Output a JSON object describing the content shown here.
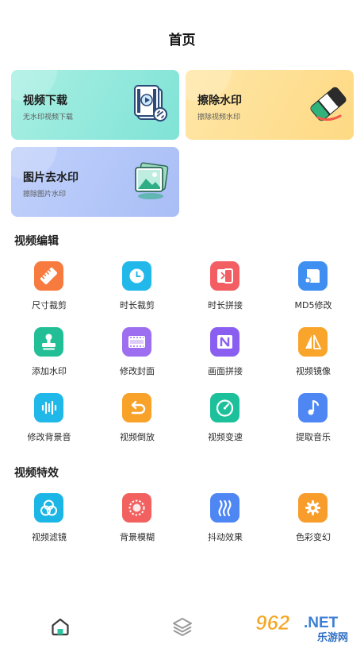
{
  "header": {
    "title": "首页"
  },
  "cards": [
    {
      "title": "视频下载",
      "subtitle": "无水印视频下载",
      "icon": "video-file-link-icon"
    },
    {
      "title": "擦除水印",
      "subtitle": "擦除视频水印",
      "icon": "eraser-icon"
    },
    {
      "title": "图片去水印",
      "subtitle": "擦除图片水印",
      "icon": "image-stack-icon"
    }
  ],
  "sections": {
    "edit": {
      "title": "视频编辑",
      "items": [
        {
          "label": "尺寸裁剪",
          "icon": "ruler-icon",
          "color": "#f77b3f"
        },
        {
          "label": "时长裁剪",
          "icon": "clock-icon",
          "color": "#22b9ea"
        },
        {
          "label": "时长拼接",
          "icon": "merge-icon",
          "color": "#f35e63"
        },
        {
          "label": "MD5修改",
          "icon": "document-icon",
          "color": "#3f8ff2"
        },
        {
          "label": "添加水印",
          "icon": "stamp-icon",
          "color": "#22bf97"
        },
        {
          "label": "修改封面",
          "icon": "film-strip-icon",
          "color": "#9d6ef0"
        },
        {
          "label": "画面拼接",
          "icon": "split-frame-icon",
          "color": "#8a5ef0"
        },
        {
          "label": "视频镜像",
          "icon": "mirror-icon",
          "color": "#f9a42a"
        },
        {
          "label": "修改背景音",
          "icon": "audio-wave-icon",
          "color": "#1fb8e8"
        },
        {
          "label": "视频倒放",
          "icon": "rewind-icon",
          "color": "#f9a22a"
        },
        {
          "label": "视频变速",
          "icon": "speedometer-icon",
          "color": "#1cc09a"
        },
        {
          "label": "提取音乐",
          "icon": "music-note-icon",
          "color": "#4e87f4"
        }
      ]
    },
    "effects": {
      "title": "视频特效",
      "items": [
        {
          "label": "视频滤镜",
          "icon": "filter-circles-icon",
          "color": "#1cb6e6"
        },
        {
          "label": "背景模糊",
          "icon": "blur-circle-icon",
          "color": "#f2615f"
        },
        {
          "label": "抖动效果",
          "icon": "shake-icon",
          "color": "#4e86f3"
        },
        {
          "label": "色彩变幻",
          "icon": "color-gear-icon",
          "color": "#f89d2b"
        }
      ]
    }
  },
  "tabbar": {
    "items": [
      {
        "icon": "home-icon",
        "active": true
      },
      {
        "icon": "layers-icon",
        "active": false
      }
    ]
  },
  "watermark": {
    "number": "962",
    "suffix": ".NET",
    "cn": "乐游网"
  }
}
